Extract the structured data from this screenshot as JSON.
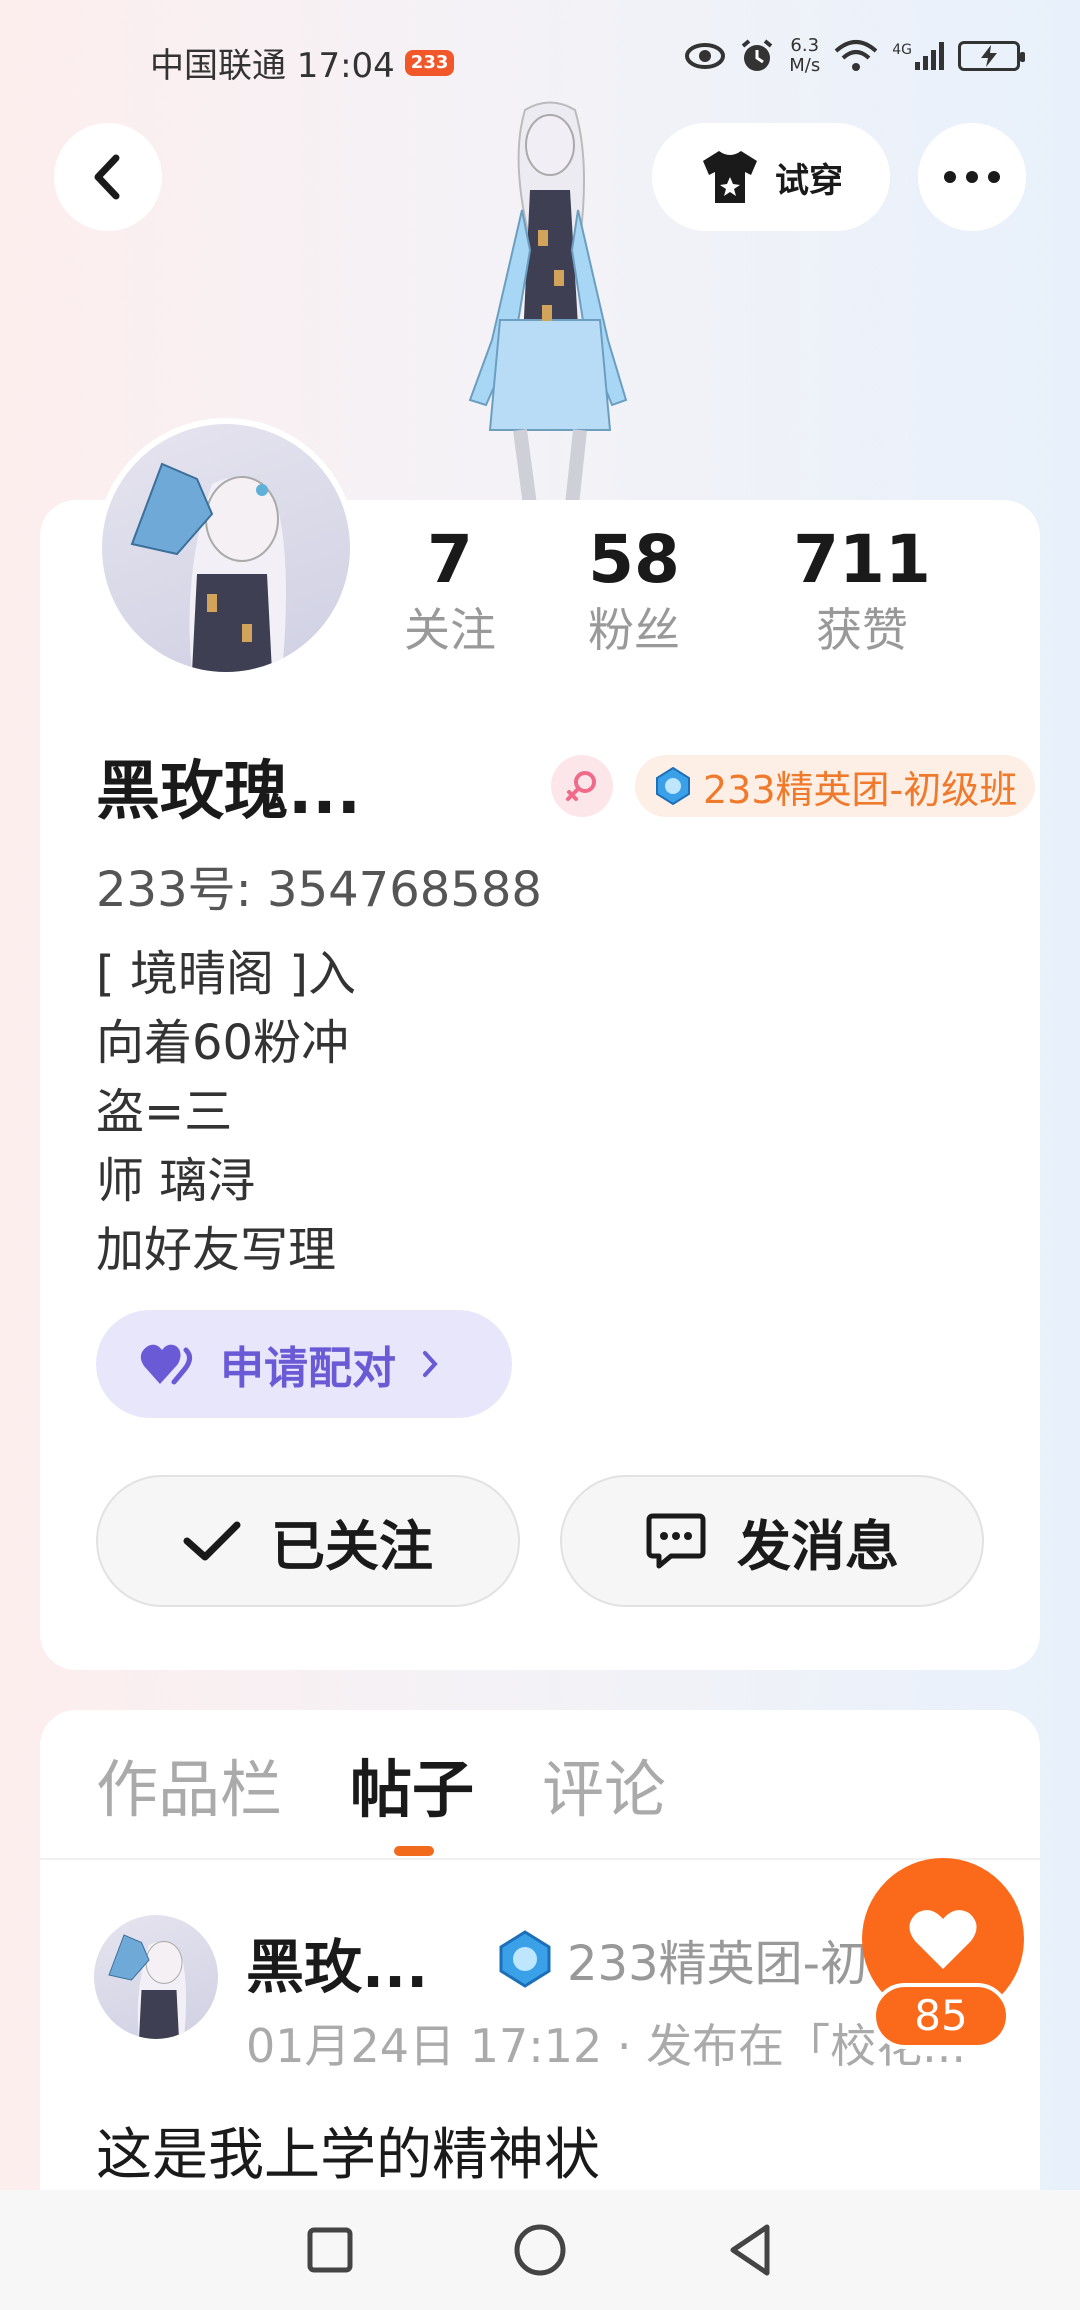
{
  "status_bar": {
    "carrier_time": "中国联通 17:04",
    "app_badge": "233",
    "net_speed_top": "6.3",
    "net_speed_bottom": "M/s",
    "network": "4G"
  },
  "header": {
    "tryon_label": "试穿"
  },
  "stats": [
    {
      "value": "7",
      "label": "关注"
    },
    {
      "value": "58",
      "label": "粉丝"
    },
    {
      "value": "711",
      "label": "获赞"
    }
  ],
  "profile": {
    "nickname": "黑玫瑰...",
    "title_badge": "233精英团-初级班",
    "user_id": "233号: 354768588",
    "bio_lines": [
      "[ 境晴阁 ]入",
      "向着60粉冲",
      "盗=三",
      "师 璃浔",
      "加好友写理"
    ],
    "match_label": "申请配对",
    "follow_label": "已关注",
    "message_label": "发消息"
  },
  "tabs": [
    {
      "label": "作品栏",
      "active": false
    },
    {
      "label": "帖子",
      "active": true
    },
    {
      "label": "评论",
      "active": false
    }
  ],
  "post": {
    "author": "黑玫...",
    "badge": "233精英团-初",
    "meta": "01月24日 17:12 · 发布在「校花...",
    "text": "这是我上学的精神状"
  },
  "like": {
    "count": "85"
  },
  "colors": {
    "accent_orange": "#fb6a1b",
    "match_purple": "#6a5ad6",
    "badge_orange": "#f07a2b"
  }
}
